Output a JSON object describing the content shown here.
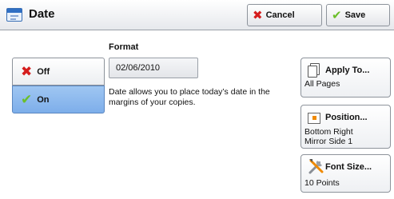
{
  "header": {
    "title": "Date",
    "icon": "calendar-window-icon",
    "cancel_label": "Cancel",
    "save_label": "Save"
  },
  "toggle": {
    "off_label": "Off",
    "on_label": "On",
    "selected": "On"
  },
  "format": {
    "label": "Format",
    "value": "02/06/2010",
    "description": "Date allows you to place today’s date in the margins of your copies."
  },
  "options": {
    "apply_to": {
      "label": "Apply To...",
      "value": "All Pages",
      "icon": "pages-icon"
    },
    "position": {
      "label": "Position...",
      "value_line1": "Bottom Right",
      "value_line2": "Mirror Side 1",
      "icon": "position-icon"
    },
    "font_size": {
      "label": "Font Size...",
      "value": "10 Points",
      "icon": "tools-icon"
    }
  },
  "colors": {
    "selected_bg": "#8fbaee",
    "cancel_icon": "#d51d1d",
    "save_icon": "#6bbf2a",
    "accent_orange": "#f08a00"
  }
}
